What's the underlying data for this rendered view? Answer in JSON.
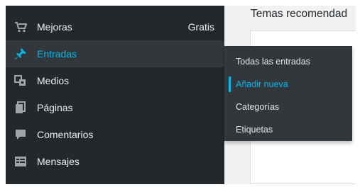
{
  "menu": {
    "items": [
      {
        "label": "Mejoras",
        "extra": "Gratis",
        "icon": "cart-icon"
      },
      {
        "label": "Entradas",
        "icon": "pin-icon"
      },
      {
        "label": "Medios",
        "icon": "media-icon"
      },
      {
        "label": "Páginas",
        "icon": "pages-icon"
      },
      {
        "label": "Comentarios",
        "icon": "comment-icon"
      },
      {
        "label": "Mensajes",
        "icon": "messages-icon"
      }
    ],
    "active_label": "Entradas"
  },
  "submenu": {
    "items": [
      {
        "label": "Todas las entradas"
      },
      {
        "label": "Añadir nueva"
      },
      {
        "label": "Categorías"
      },
      {
        "label": "Etiquetas"
      }
    ],
    "current_label": "Añadir nueva"
  },
  "content": {
    "title": "Temas recomendad"
  },
  "colors": {
    "sidebar_bg": "#23282d",
    "active_bg": "#32373c",
    "accent": "#00b9eb"
  }
}
